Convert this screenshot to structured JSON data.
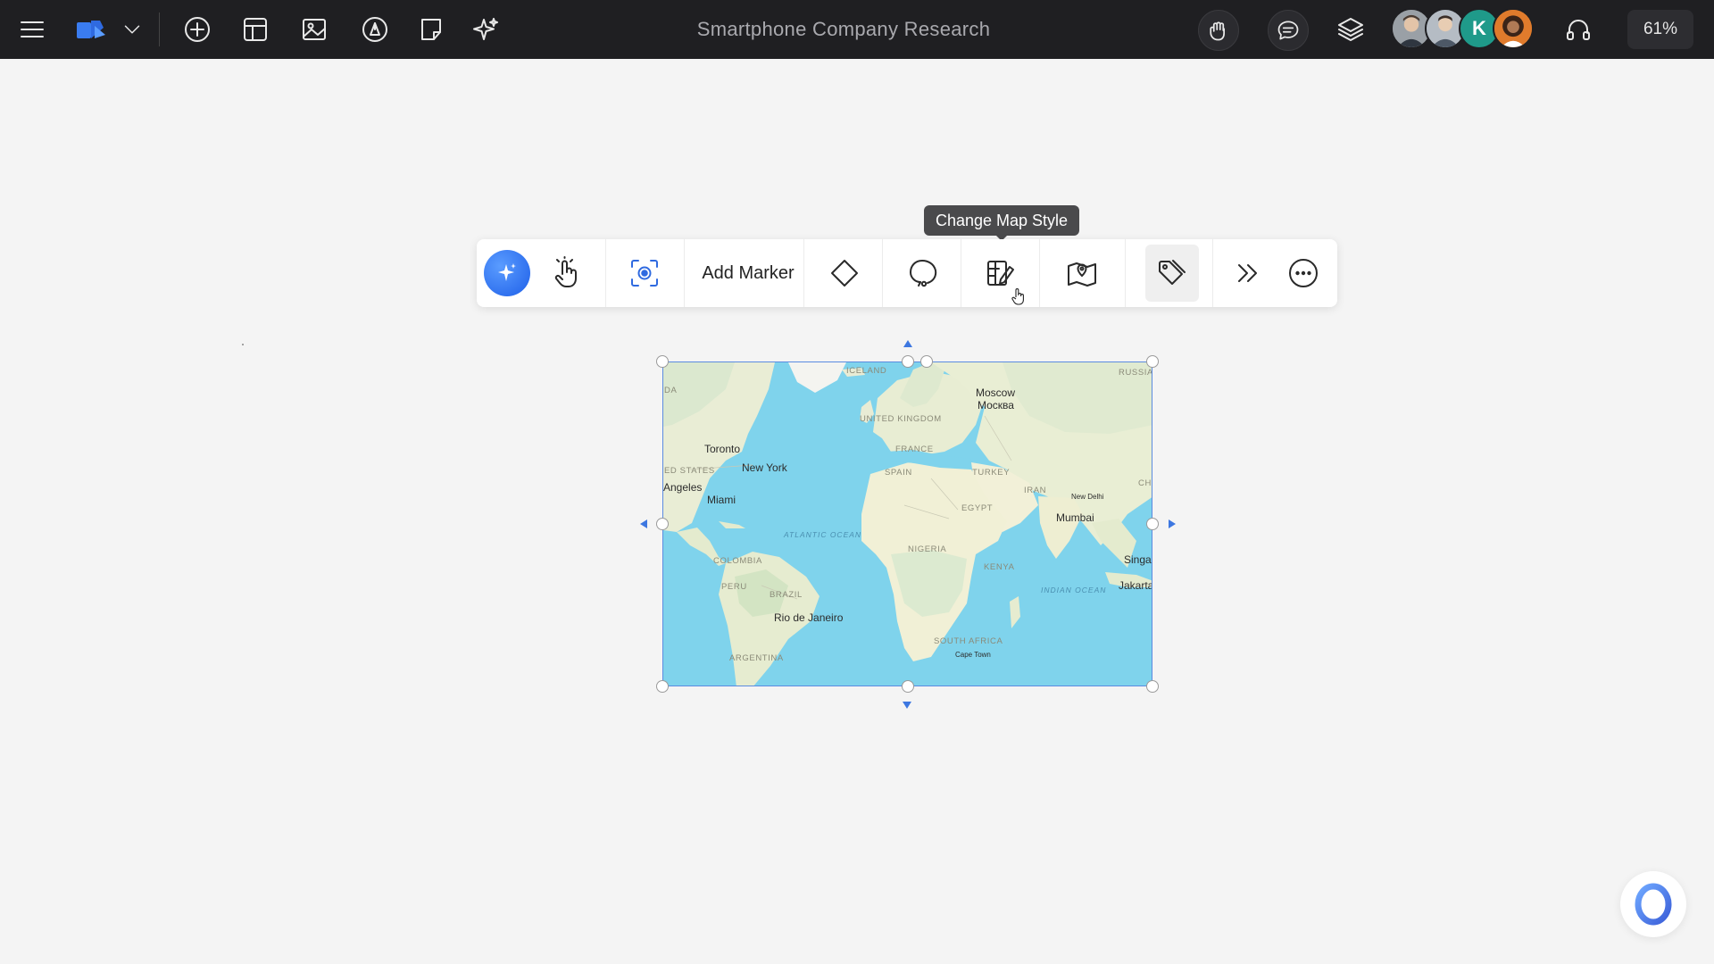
{
  "header": {
    "title": "Smartphone Company Research",
    "zoom": "61%",
    "avatar_initial": "K"
  },
  "tooltip": {
    "text": "Change Map Style"
  },
  "toolbar": {
    "add_marker_label": "Add Marker"
  },
  "map": {
    "cities": [
      "Moscow",
      "Москва",
      "Toronto",
      "New York",
      "Angeles",
      "Miami",
      "Mumbai",
      "New Delhi",
      "Singa",
      "Jakarta",
      "Rio de Janeiro",
      "Cape Town"
    ],
    "countries": [
      "ICELAND",
      "RUSSIA",
      "UNITED KINGDOM",
      "FRANCE",
      "SPAIN",
      "TURKEY",
      "ED STATES",
      "EGYPT",
      "IRAN",
      "CHI",
      "NIGERIA",
      "KENYA",
      "COLOMBIA",
      "PERU",
      "BRAZIL",
      "SOUTH AFRICA",
      "ARGENTINA",
      "DA"
    ],
    "oceans": [
      "ATLANTIC OCEAN",
      "INDIAN OCEAN"
    ]
  },
  "colors": {
    "topbar": "#1f1f22",
    "accent": "#1e5fe8",
    "water": "#7fd3ec",
    "land": "#eef0d8"
  },
  "icons": {
    "menu": "hamburger-icon",
    "app": "app-logo-icon",
    "add": "plus-circle-icon",
    "layout": "layout-icon",
    "media": "image-icon",
    "pen": "pen-icon",
    "note": "sticky-note-icon",
    "ai": "sparkle-icon"
  }
}
